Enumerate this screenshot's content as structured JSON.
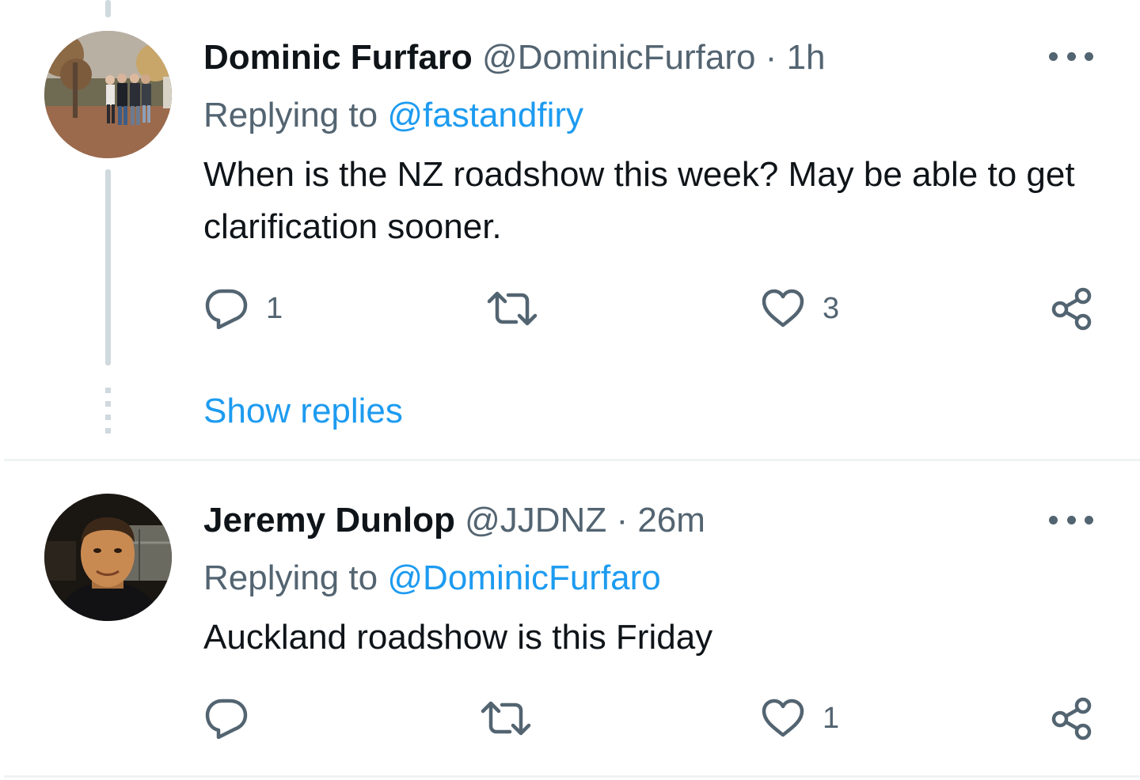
{
  "tweets": [
    {
      "display_name": "Dominic Furfaro",
      "handle": "@DominicFurfaro",
      "separator": "·",
      "time": "1h",
      "replying_prefix": "Replying to",
      "replying_to": "@fastandfiry",
      "text": "When is the NZ roadshow this week? May be able to get clarification sooner.",
      "reply_count": "1",
      "retweet_count": "",
      "like_count": "3",
      "avatar_icon": "group-photo-avatar"
    },
    {
      "display_name": "Jeremy Dunlop",
      "handle": "@JJDNZ",
      "separator": "·",
      "time": "26m",
      "replying_prefix": "Replying to",
      "replying_to": "@DominicFurfaro",
      "text": "Auckland roadshow is this Friday",
      "reply_count": "",
      "retweet_count": "",
      "like_count": "1",
      "avatar_icon": "portrait-photo-avatar"
    }
  ],
  "show_replies_label": "Show replies",
  "icons": {
    "reply": "reply-bubble-icon",
    "retweet": "retweet-arrows-icon",
    "like": "heart-icon",
    "share": "share-nodes-icon",
    "more": "more-dots-icon"
  },
  "colors": {
    "text_primary": "#0f1419",
    "text_secondary": "#536471",
    "link": "#1d9bf0",
    "thread_line": "#cfd9de",
    "divider": "#eff3f4"
  }
}
